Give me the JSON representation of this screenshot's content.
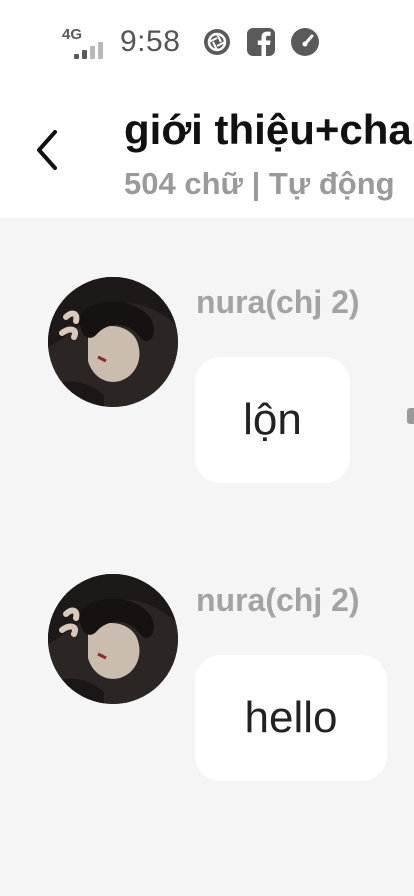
{
  "status_bar": {
    "network": "4G",
    "time": "9:58",
    "icons": [
      "aperture-icon",
      "facebook-icon",
      "speedometer-icon"
    ]
  },
  "header": {
    "back_icon": "chevron-left-icon",
    "title": "giới thiệu+cha",
    "subtitle": "504 chữ | Tự động"
  },
  "messages": [
    {
      "sender": "nura(chj 2)",
      "text": "lộn",
      "avatar": "anime-girl-avatar"
    },
    {
      "sender": "nura(chj 2)",
      "text": "hello",
      "avatar": "anime-girl-avatar"
    }
  ],
  "colors": {
    "background": "#f5f5f5",
    "bubble": "#ffffff",
    "sender_name": "#a3a3a3",
    "subtitle": "#9a9a9a"
  }
}
